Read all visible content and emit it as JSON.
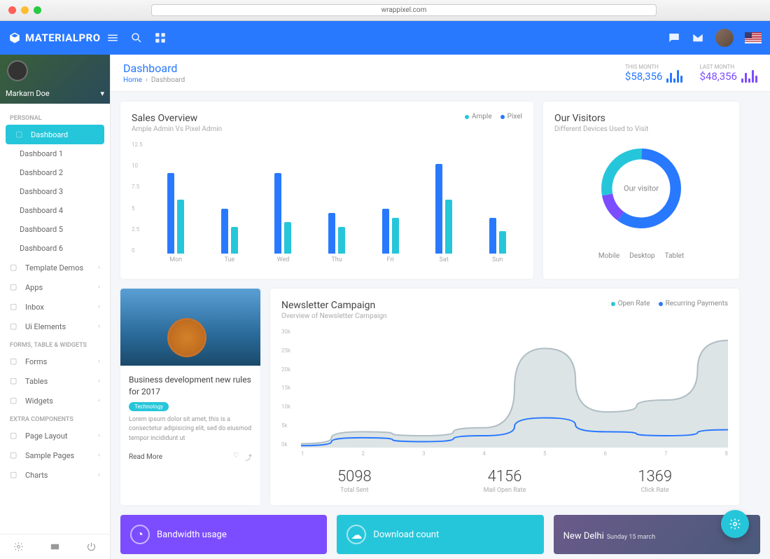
{
  "browser": {
    "url": "wrappixel.com"
  },
  "brand": "MATERIALPRO",
  "user": {
    "name": "Markarn Doe"
  },
  "page": {
    "title": "Dashboard",
    "breadcrumb_home": "Home",
    "breadcrumb_current": "Dashboard"
  },
  "metrics": {
    "this_month": {
      "label": "THIS MONTH",
      "value": "$58,356"
    },
    "last_month": {
      "label": "LAST MONTH",
      "value": "$48,356"
    }
  },
  "sidebar": {
    "sections": [
      {
        "label": "PERSONAL",
        "items": [
          {
            "label": "Dashboard",
            "active": true
          },
          {
            "label": "Dashboard 1",
            "sub": true
          },
          {
            "label": "Dashboard 2",
            "sub": true
          },
          {
            "label": "Dashboard 3",
            "sub": true
          },
          {
            "label": "Dashboard 4",
            "sub": true
          },
          {
            "label": "Dashboard 5",
            "sub": true
          },
          {
            "label": "Dashboard 6",
            "sub": true
          },
          {
            "label": "Template Demos",
            "chev": true
          },
          {
            "label": "Apps",
            "chev": true
          },
          {
            "label": "Inbox",
            "chev": true
          },
          {
            "label": "Ui Elements",
            "chev": true
          }
        ]
      },
      {
        "label": "FORMS, TABLE & WIDGETS",
        "items": [
          {
            "label": "Forms",
            "chev": true
          },
          {
            "label": "Tables",
            "chev": true
          },
          {
            "label": "Widgets",
            "chev": true
          }
        ]
      },
      {
        "label": "EXTRA COMPONENTS",
        "items": [
          {
            "label": "Page Layout",
            "chev": true
          },
          {
            "label": "Sample Pages",
            "chev": true
          },
          {
            "label": "Charts",
            "chev": true
          }
        ]
      }
    ]
  },
  "sales": {
    "title": "Sales Overview",
    "subtitle": "Ample Admin Vs Pixel Admin",
    "legend": [
      "Ample",
      "Pixel"
    ],
    "colors": {
      "ample": "#26c6da",
      "pixel": "#2979ff"
    }
  },
  "visitors": {
    "title": "Our Visitors",
    "subtitle": "Different Devices Used to Visit",
    "center": "Our visitor",
    "legend": [
      "Mobile",
      "Desktop",
      "Tablet"
    ]
  },
  "news": {
    "title": "Business development new rules for 2017",
    "tag": "Technology",
    "body": "Lorem ipsum dolor sit amet, this is a consectetur adipisicing elit, sed do eiusmod tempor incididunt ut",
    "read_more": "Read More"
  },
  "newsletter": {
    "title": "Newsletter Campaign",
    "subtitle": "Overview of Newsletter Campaign",
    "legend": [
      "Open Rate",
      "Recurring Payments"
    ],
    "stats": [
      {
        "num": "5098",
        "label": "Total Sent"
      },
      {
        "num": "4156",
        "label": "Mail Open Rate"
      },
      {
        "num": "1369",
        "label": "Click Rate"
      }
    ]
  },
  "tiles": {
    "bandwidth": {
      "title": "Bandwidth usage"
    },
    "download": {
      "title": "Download count"
    },
    "weather": {
      "city": "New Delhi",
      "date": "Sunday 15 march"
    }
  },
  "chart_data": [
    {
      "type": "bar",
      "id": "sales_overview",
      "categories": [
        "Mon",
        "Tue",
        "Wed",
        "Thu",
        "Fri",
        "Sat",
        "Sun"
      ],
      "series": [
        {
          "name": "Ample",
          "values": [
            9,
            5,
            9,
            4.5,
            5,
            10,
            4
          ],
          "color": "#2979ff"
        },
        {
          "name": "Pixel",
          "values": [
            6,
            3,
            3.5,
            3,
            4,
            6,
            2.5
          ],
          "color": "#26c6da"
        }
      ],
      "ylim": [
        0,
        12.5
      ],
      "yticks": [
        0,
        2.5,
        5,
        7.5,
        10,
        12.5
      ]
    },
    {
      "type": "pie",
      "id": "our_visitors",
      "slices": [
        {
          "name": "Mobile",
          "value": 60,
          "color": "#2979ff"
        },
        {
          "name": "Desktop",
          "value": 12,
          "color": "#7c4dff"
        },
        {
          "name": "Tablet",
          "value": 28,
          "color": "#26c6da"
        }
      ],
      "center_label": "Our visitor"
    },
    {
      "type": "area",
      "id": "newsletter_campaign",
      "x": [
        1,
        2,
        3,
        4,
        5,
        6,
        7,
        8
      ],
      "series": [
        {
          "name": "Recurring Payments",
          "values": [
            1000,
            4000,
            3000,
            5000,
            25000,
            9000,
            12000,
            27000
          ],
          "color": "#b0bec5"
        },
        {
          "name": "Open Rate",
          "values": [
            500,
            2500,
            1500,
            3000,
            7500,
            4000,
            3000,
            4500
          ],
          "color": "#2979ff"
        }
      ],
      "ylim": [
        0,
        30000
      ],
      "yticks": [
        "0k",
        "5k",
        "10k",
        "15k",
        "20k",
        "25k",
        "30k"
      ]
    }
  ]
}
